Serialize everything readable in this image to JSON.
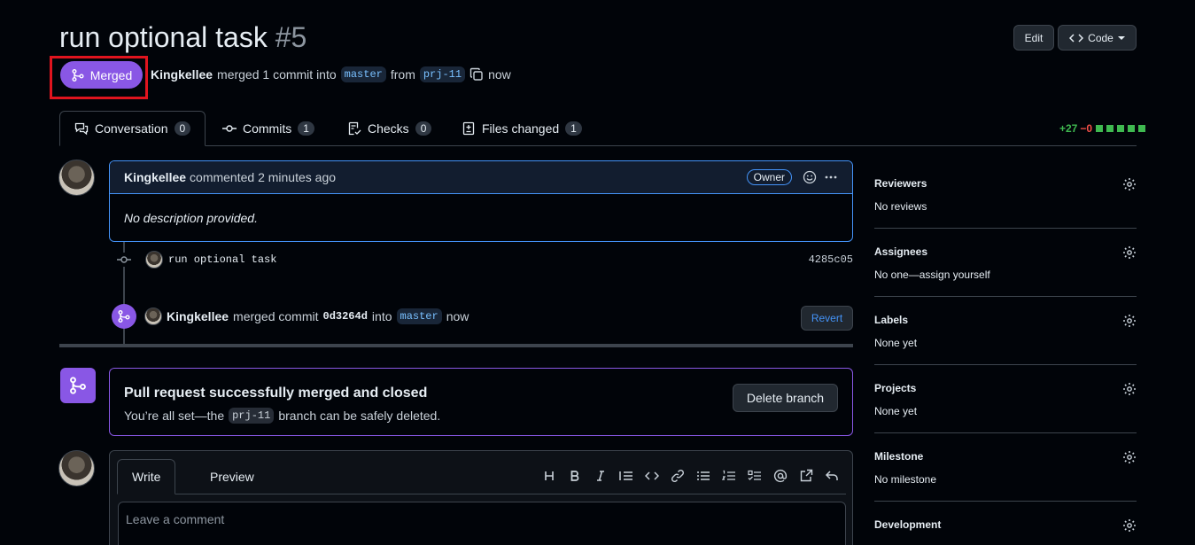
{
  "pr": {
    "title": "run optional task",
    "number": "#5",
    "status": "Merged",
    "author": "Kingkellee",
    "merge_text": "merged 1 commit into",
    "base_branch": "master",
    "from_text": "from",
    "head_branch": "prj-11",
    "time": "now"
  },
  "header": {
    "edit_label": "Edit",
    "code_label": "Code"
  },
  "tabs": [
    {
      "label": "Conversation",
      "count": "0"
    },
    {
      "label": "Commits",
      "count": "1"
    },
    {
      "label": "Checks",
      "count": "0"
    },
    {
      "label": "Files changed",
      "count": "1"
    }
  ],
  "diffstat": {
    "additions": "+27",
    "deletions": "−0"
  },
  "comment": {
    "author": "Kingkellee",
    "action": "commented 2 minutes ago",
    "badge": "Owner",
    "body": "No description provided."
  },
  "commit": {
    "message": "run optional task",
    "sha": "4285c05"
  },
  "merge_event": {
    "author": "Kingkellee",
    "text1": "merged commit",
    "sha": "0d3264d",
    "text2": "into",
    "branch": "master",
    "time": "now",
    "revert_label": "Revert"
  },
  "merged_box": {
    "heading": "Pull request successfully merged and closed",
    "sub_pre": "You’re all set—the",
    "branch": "prj-11",
    "sub_post": "branch can be safely deleted.",
    "delete_label": "Delete branch"
  },
  "composer": {
    "write_tab": "Write",
    "preview_tab": "Preview",
    "placeholder": "Leave a comment"
  },
  "sidebar": [
    {
      "title": "Reviewers",
      "value": "No reviews"
    },
    {
      "title": "Assignees",
      "value": "No one—assign yourself"
    },
    {
      "title": "Labels",
      "value": "None yet"
    },
    {
      "title": "Projects",
      "value": "None yet"
    },
    {
      "title": "Milestone",
      "value": "No milestone"
    },
    {
      "title": "Development",
      "value": ""
    }
  ],
  "colors": {
    "merged": "#8957e5",
    "link": "#4493f8",
    "background": "#010409"
  }
}
